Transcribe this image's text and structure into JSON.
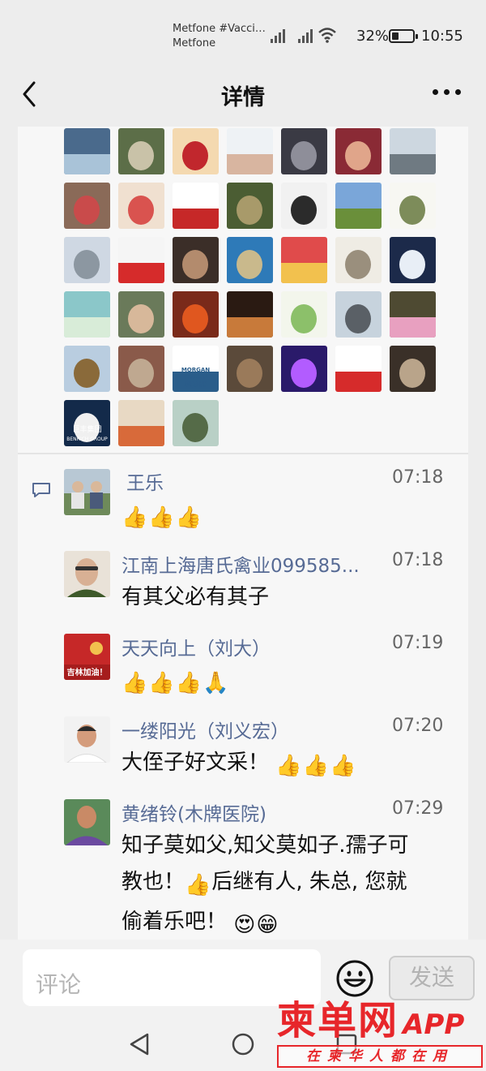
{
  "status_bar": {
    "carrier_line1": "Metfone #Vaccin...",
    "carrier_line2": "Metfone",
    "battery": "32%",
    "battery_level": 0.32,
    "time": "10:55"
  },
  "nav": {
    "title": "详情",
    "back_icon": "chevron-left-icon",
    "more_icon": "more-icon"
  },
  "likes": {
    "avatars": [
      {
        "colors": [
          "#4a6a8c",
          "#a9c3d8"
        ]
      },
      {
        "colors": [
          "#5c6e48",
          "#c9c2a8"
        ]
      },
      {
        "colors": [
          "#f4d9b0",
          "#c1272d"
        ]
      },
      {
        "colors": [
          "#eef2f5",
          "#d8b5a0"
        ]
      },
      {
        "colors": [
          "#3a3a44",
          "#8e8e99"
        ]
      },
      {
        "colors": [
          "#8a2a35",
          "#e0a58a"
        ]
      },
      {
        "colors": [
          "#cdd7e0",
          "#6f7a82"
        ]
      },
      {
        "colors": [
          "#8a6a58",
          "#c94b4b"
        ]
      },
      {
        "colors": [
          "#f0e0d0",
          "#d9534f"
        ]
      },
      {
        "colors": [
          "#ffffff",
          "#c62828"
        ]
      },
      {
        "colors": [
          "#4b5d33",
          "#a89a6a"
        ]
      },
      {
        "colors": [
          "#f1f1f1",
          "#2b2b2b"
        ]
      },
      {
        "colors": [
          "#7aa6d9",
          "#6a8f3a"
        ]
      },
      {
        "colors": [
          "#f7f7f2",
          "#7d8c5a"
        ]
      },
      {
        "colors": [
          "#cfd8e3",
          "#8c97a1"
        ]
      },
      {
        "colors": [
          "#f5f5f5",
          "#d62b2b"
        ]
      },
      {
        "colors": [
          "#3b2e28",
          "#b38b6d"
        ]
      },
      {
        "colors": [
          "#2e7ab8",
          "#c9b98c"
        ]
      },
      {
        "colors": [
          "#e04b4b",
          "#f2c14e"
        ]
      },
      {
        "colors": [
          "#efece4",
          "#9a8f7d"
        ]
      },
      {
        "colors": [
          "#1c2a4a",
          "#e8eef6"
        ]
      },
      {
        "colors": [
          "#8bc7c9",
          "#d8ecd8"
        ]
      },
      {
        "colors": [
          "#6a7a5a",
          "#d7b89a"
        ]
      },
      {
        "colors": [
          "#7a2a1a",
          "#e0571f"
        ]
      },
      {
        "colors": [
          "#2a1a12",
          "#c87a3a"
        ]
      },
      {
        "colors": [
          "#f3f6ec",
          "#8cc06a"
        ]
      },
      {
        "colors": [
          "#c7d3dd",
          "#5a6066"
        ]
      },
      {
        "colors": [
          "#4e4a32",
          "#e8a0c0"
        ]
      },
      {
        "colors": [
          "#b9cde0",
          "#8a6a3a"
        ]
      },
      {
        "colors": [
          "#8a5a4a",
          "#bfa890"
        ]
      },
      {
        "colors": [
          "#ffffff",
          "#2a5d8a"
        ]
      },
      {
        "colors": [
          "#5b4a3a",
          "#9a7a5a"
        ]
      },
      {
        "colors": [
          "#2a1a6a",
          "#b25cff"
        ]
      },
      {
        "colors": [
          "#ffffff",
          "#d62b2b"
        ]
      },
      {
        "colors": [
          "#3a3028",
          "#b9a48a"
        ]
      },
      {
        "colors": [
          "#132a4a",
          "#f0f0f0"
        ]
      },
      {
        "colors": [
          "#e8d9c4",
          "#d86a3a"
        ]
      },
      {
        "colors": [
          "#b9d0c6",
          "#556b48"
        ]
      }
    ],
    "brand_labels": {
      "morgan": "MORGAN GROUP",
      "morgan_cn": "摩根集团",
      "jufeng": "巨丰集团",
      "jufeng_en": "BENRICH GROUP"
    }
  },
  "comments": [
    {
      "name": "王乐",
      "time": "07:18",
      "text": "",
      "emojis": "👍👍👍",
      "avatar_colors": [
        "#5a7a9a",
        "#c7b08a"
      ]
    },
    {
      "name": "江南上海唐氏禽业099585...",
      "time": "07:18",
      "text": "有其父必有其子",
      "emojis": "",
      "avatar_colors": [
        "#d9c0a8",
        "#3e5a2a"
      ]
    },
    {
      "name": "天天向上（刘大）",
      "time": "07:19",
      "text": "",
      "emojis": "👍👍👍🙏",
      "avatar_colors": [
        "#c62828",
        "#f2c14e"
      ],
      "avatar_text": "吉林加油！"
    },
    {
      "name": "一缕阳光（刘义宏）",
      "time": "07:20",
      "text": "大侄子好文采！",
      "emojis": "👍👍👍",
      "avatar_colors": [
        "#f4f4f4",
        "#d9a184"
      ]
    },
    {
      "name": "黄绪铃(木牌医院)",
      "time": "07:29",
      "text_lines": [
        "知子莫如父,知父莫如子.孺子可",
        "教也！",
        "后继有人, 朱总, 您就",
        "偷着乐吧！"
      ],
      "emojis_inline": "👍",
      "emojis_end": "😍😁",
      "avatar_colors": [
        "#3a6a3a",
        "#6b4aa0"
      ]
    }
  ],
  "input": {
    "placeholder": "评论",
    "send_label": "发送",
    "emoji_icon": "smiley-icon"
  },
  "system_nav": {
    "back_icon": "triangle-back-icon",
    "home_icon": "circle-home-icon",
    "recents_icon": "square-recents-icon"
  },
  "watermark": {
    "title": "柬单网",
    "app": "APP",
    "slogan": "在柬华人都在用"
  }
}
